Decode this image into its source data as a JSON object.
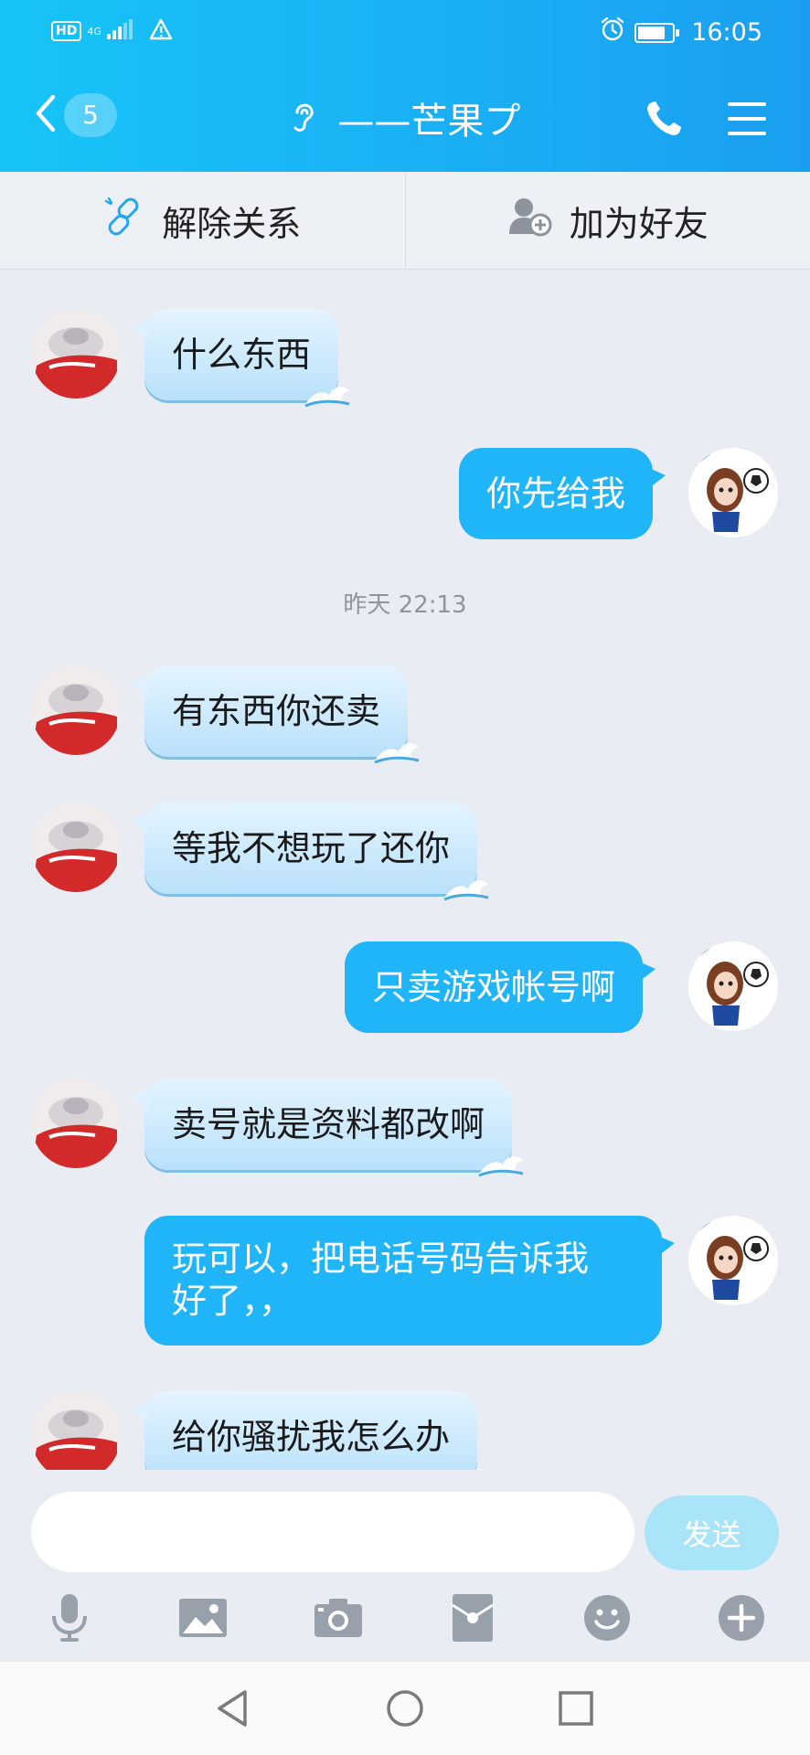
{
  "status_bar": {
    "hd": "HD",
    "network": "4G",
    "time": "16:05",
    "battery_level": 0.8
  },
  "header": {
    "unread_count": "5",
    "contact_name": "——芒果プ"
  },
  "actions": {
    "unlink_label": "解除关系",
    "add_friend_label": "加为好友"
  },
  "messages": [
    {
      "side": "left",
      "text": "什么东西"
    },
    {
      "side": "right",
      "text": "你先给我"
    },
    {
      "side": "left",
      "text": "有东西你还卖"
    },
    {
      "side": "left",
      "text": "等我不想玩了还你"
    },
    {
      "side": "right",
      "text": "只卖游戏帐号啊"
    },
    {
      "side": "left",
      "text": "卖号就是资料都改啊"
    },
    {
      "side": "right",
      "text_line1": "玩可以，把电话号码告诉我",
      "text_line2": "好了，，"
    },
    {
      "side": "left",
      "text": "给你骚扰我怎么办"
    }
  ],
  "timestamp": "昨天 22:13",
  "input": {
    "value": "",
    "send_label": "发送"
  },
  "colors": {
    "header_start": "#16c4f8",
    "header_end": "#1a9ff0",
    "outgoing_bubble": "#1fb5f8",
    "incoming_bubble": "#c8e8fc",
    "send_button": "#a9e4f8",
    "background": "#e9ecf3"
  },
  "icons": {
    "back": "chevron-left-icon",
    "ear": "ear-icon",
    "call": "phone-icon",
    "menu": "menu-icon",
    "unlink": "unlink-icon",
    "add_friend": "add-friend-icon",
    "toolbar": [
      "microphone-icon",
      "image-icon",
      "camera-icon",
      "red-packet-icon",
      "emoji-icon",
      "plus-icon"
    ],
    "system_nav": [
      "back-triangle-icon",
      "home-circle-icon",
      "recents-square-icon"
    ]
  }
}
